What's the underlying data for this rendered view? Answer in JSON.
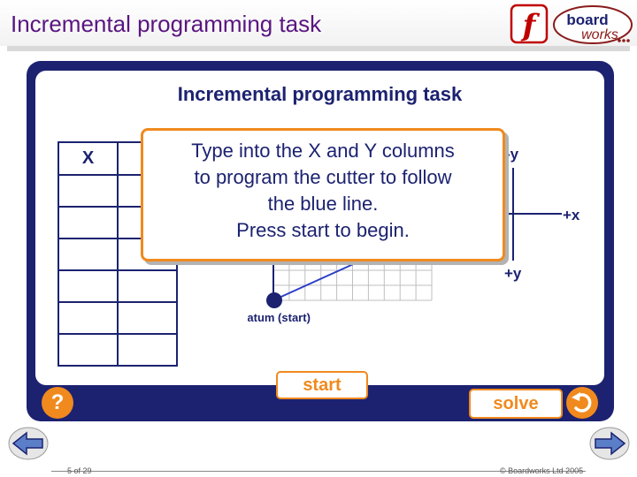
{
  "header": {
    "title": "Incremental programming task",
    "brand_line1": "board",
    "brand_line2": "works",
    "flash_glyph": "f"
  },
  "task": {
    "title": "Incremental programming task",
    "table": {
      "col_x_label": "X",
      "col_y_label": "",
      "rows": 6
    },
    "instructions": [
      "Type into the X and Y columns",
      "to program the cutter to follow",
      "the blue line.",
      "Press start to begin."
    ],
    "grid": {
      "axis_labels": {
        "minus_y": "-y",
        "plus_x": "+x",
        "plus_y": "+y"
      },
      "datum_label": "Datum (start)"
    }
  },
  "controls": {
    "start_label": "start",
    "solve_label": "solve",
    "help_label": "?",
    "reset_icon": "undo-arrow-icon"
  },
  "footer": {
    "page_counter": "5 of 29",
    "copyright": "© Boardworks Ltd 2005"
  },
  "colors": {
    "title_purple": "#5a1580",
    "frame_navy": "#1c2270",
    "accent_orange": "#f08a1e",
    "path_blue": "#2a3fc8",
    "grid_gray": "#bfbfbf"
  }
}
